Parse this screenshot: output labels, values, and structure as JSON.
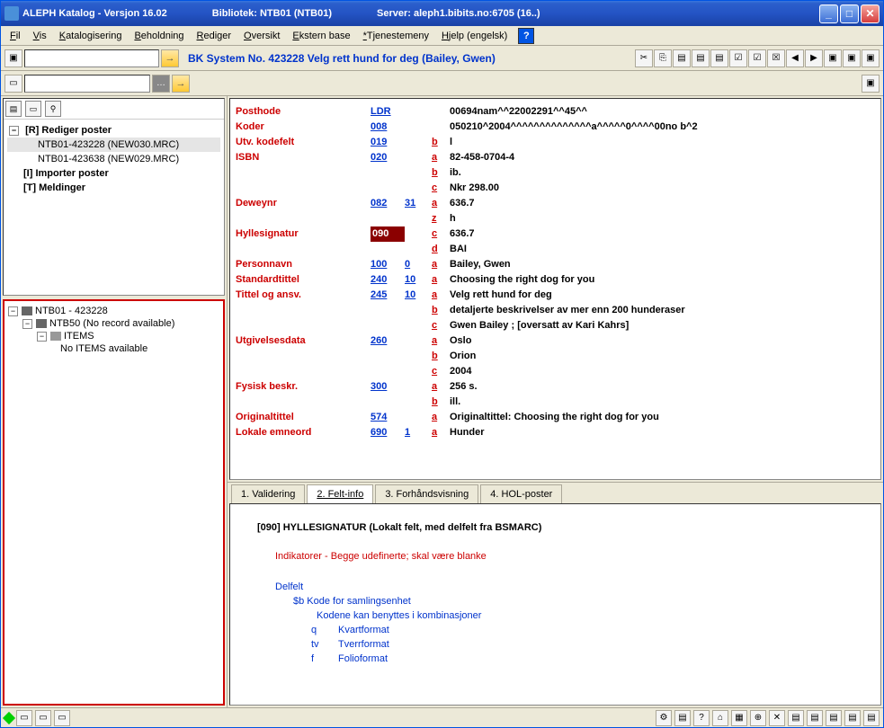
{
  "title": {
    "app": "ALEPH Katalog - Versjon 16.02",
    "lib": "Bibliotek:  NTB01 (NTB01)",
    "server": "Server:  aleph1.bibits.no:6705 (16..)"
  },
  "menu": [
    "Fil",
    "Vis",
    "Katalogisering",
    "Beholdning",
    "Rediger",
    "Oversikt",
    "Ekstern base",
    "*Tjenestemeny",
    "Hjelp (engelsk)"
  ],
  "recordTitle": "BK System No. 423228 Velg rett hund for deg (Bailey, Gwen)",
  "leftTree": {
    "root": "[R] Rediger poster",
    "items": [
      "NTB01-423228 (NEW030.MRC)",
      "NTB01-423638 (NEW029.MRC)"
    ],
    "other": [
      "[I] Importer poster",
      "[T] Meldinger"
    ]
  },
  "subTree": {
    "root": "NTB01 - 423228",
    "child1": "NTB50 (No record available)",
    "child2": "ITEMS",
    "child3": "No ITEMS available"
  },
  "marc": [
    {
      "label": "Posthode",
      "tag": "LDR",
      "ind": "",
      "subs": [
        [
          "",
          "00694nam^^22002291^^45^^"
        ]
      ]
    },
    {
      "label": "Koder",
      "tag": "008",
      "ind": "",
      "subs": [
        [
          "",
          "050210^2004^^^^^^^^^^^^^^a^^^^^0^^^^00no b^2"
        ]
      ]
    },
    {
      "label": "Utv. kodefelt",
      "tag": "019",
      "ind": "",
      "subs": [
        [
          "b",
          "l"
        ]
      ]
    },
    {
      "label": "ISBN",
      "tag": "020",
      "ind": "",
      "subs": [
        [
          "a",
          "82-458-0704-4"
        ],
        [
          "b",
          "ib."
        ],
        [
          "c",
          "Nkr 298.00"
        ]
      ]
    },
    {
      "label": "Deweynr",
      "tag": "082",
      "ind": "31",
      "subs": [
        [
          "a",
          "636.7"
        ],
        [
          "z",
          "h"
        ]
      ]
    },
    {
      "label": "Hyllesignatur",
      "tag": "090",
      "ind": "",
      "hi": true,
      "subs": [
        [
          "c",
          "636.7"
        ],
        [
          "d",
          "BAI"
        ]
      ]
    },
    {
      "label": "Personnavn",
      "tag": "100",
      "ind": "0",
      "subs": [
        [
          "a",
          "Bailey, Gwen"
        ]
      ]
    },
    {
      "label": "Standardtittel",
      "tag": "240",
      "ind": "10",
      "subs": [
        [
          "a",
          "Choosing the right dog for you"
        ]
      ]
    },
    {
      "label": "Tittel og ansv.",
      "tag": "245",
      "ind": "10",
      "subs": [
        [
          "a",
          "Velg rett hund for deg"
        ],
        [
          "b",
          "detaljerte beskrivelser av mer enn 200 hunderaser"
        ],
        [
          "c",
          "Gwen Bailey ; [oversatt av Kari Kahrs]"
        ]
      ]
    },
    {
      "label": "Utgivelsesdata",
      "tag": "260",
      "ind": "",
      "subs": [
        [
          "a",
          "Oslo"
        ],
        [
          "b",
          "Orion"
        ],
        [
          "c",
          "2004"
        ]
      ]
    },
    {
      "label": "Fysisk beskr.",
      "tag": "300",
      "ind": "",
      "subs": [
        [
          "a",
          "256 s."
        ],
        [
          "b",
          "ill."
        ]
      ]
    },
    {
      "label": "Originaltittel",
      "tag": "574",
      "ind": "",
      "subs": [
        [
          "a",
          "Originaltittel: Choosing the right dog for you"
        ]
      ]
    },
    {
      "label": "Lokale emneord",
      "tag": "690",
      "ind": "1",
      "subs": [
        [
          "a",
          "Hunder"
        ]
      ]
    }
  ],
  "tabs": [
    "1. Validering",
    "2. Felt-info",
    "3. Forhåndsvisning",
    "4. HOL-poster"
  ],
  "info": {
    "title": "[090] HYLLESIGNATUR (Lokalt felt, med delfelt fra BSMARC)",
    "red": "Indikatorer - Begge udefinerte; skal være blanke",
    "delfelt": "Delfelt",
    "sb": "$b   Kode for samlingsenhet",
    "komb": "Kodene kan benyttes i kombinasjoner",
    "codes": [
      [
        "q",
        "Kvartformat"
      ],
      [
        "tv",
        "Tverrformat"
      ],
      [
        "f",
        "Folioformat"
      ]
    ]
  }
}
